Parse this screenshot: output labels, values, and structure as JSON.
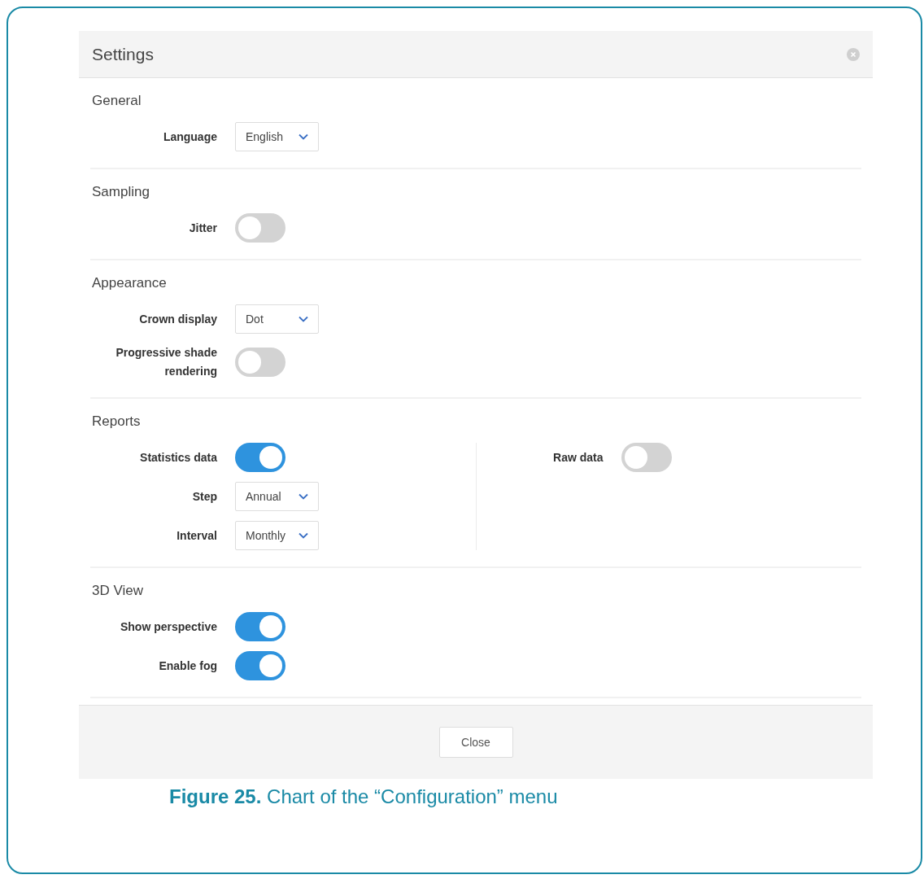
{
  "dialog": {
    "title": "Settings",
    "sections": [
      {
        "title": "General",
        "columns": [
          [
            {
              "kind": "select",
              "label": "Language",
              "value": "English"
            }
          ]
        ]
      },
      {
        "title": "Sampling",
        "columns": [
          [
            {
              "kind": "toggle",
              "label": "Jitter",
              "on": false
            }
          ]
        ]
      },
      {
        "title": "Appearance",
        "columns": [
          [
            {
              "kind": "select",
              "label": "Crown display",
              "value": "Dot"
            },
            {
              "kind": "toggle",
              "label": "Progressive shade rendering",
              "on": false
            }
          ]
        ]
      },
      {
        "title": "Reports",
        "columns": [
          [
            {
              "kind": "toggle",
              "label": "Statistics data",
              "on": true
            },
            {
              "kind": "select",
              "label": "Step",
              "value": "Annual"
            },
            {
              "kind": "select",
              "label": "Interval",
              "value": "Monthly"
            }
          ],
          [
            {
              "kind": "toggle",
              "label": "Raw data",
              "on": false
            }
          ]
        ]
      },
      {
        "title": "3D View",
        "columns": [
          [
            {
              "kind": "toggle",
              "label": "Show perspective",
              "on": true
            },
            {
              "kind": "toggle",
              "label": "Enable fog",
              "on": true
            }
          ]
        ]
      }
    ],
    "buttons": [
      "Close"
    ]
  },
  "caption": "**Figure 25.** Chart of the “Configuration” menu"
}
